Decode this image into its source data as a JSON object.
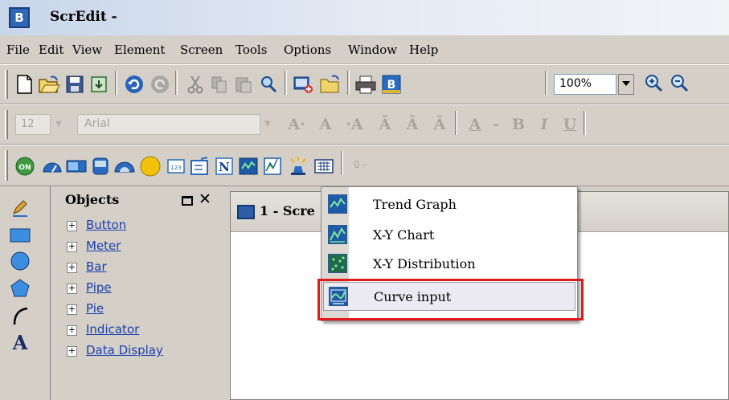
{
  "window": {
    "title": "ScrEdit -",
    "app_icon_letter": "B"
  },
  "menubar": {
    "items": [
      "File",
      "Edit",
      "View",
      "Element",
      "Screen",
      "Tools",
      "Options",
      "Window",
      "Help"
    ]
  },
  "toolbar_main": {
    "zoom_value": "100%",
    "icons": [
      "new-file-icon",
      "open-folder-icon",
      "save-icon",
      "import-icon",
      "undo-icon",
      "redo-icon",
      "cut-icon",
      "copy-icon",
      "paste-icon",
      "find-icon",
      "add-screen-icon",
      "open-screen-icon",
      "print-icon",
      "compile-icon",
      "zoom-in-icon",
      "zoom-out-icon"
    ]
  },
  "toolbar_format": {
    "font_size": "12",
    "font_name": "Arial",
    "buttons": [
      "A·",
      "A",
      "·A",
      "Ā",
      "Ā",
      "Ā",
      "A",
      "-",
      "B",
      "I",
      "U"
    ]
  },
  "toolbar_elements": {
    "icons": [
      "button-on-icon",
      "meter-icon",
      "bar-icon",
      "pipe-icon",
      "pie-icon",
      "indicator-icon",
      "data-display-icon",
      "input-icon",
      "numeric-icon",
      "trend-graph-icon",
      "xy-chart-icon",
      "alarm-icon",
      "keypad-icon"
    ],
    "right_field": "0 -"
  },
  "objects_panel": {
    "title": "Objects",
    "items": [
      "Button",
      "Meter",
      "Bar",
      "Pipe",
      "Pie",
      "Indicator",
      "Data Display"
    ]
  },
  "screen_window": {
    "title": "1 - Scre"
  },
  "context_menu": {
    "items": [
      {
        "label": "Trend Graph"
      },
      {
        "label": "X-Y Chart"
      },
      {
        "label": "X-Y Distribution"
      },
      {
        "label": "Curve input"
      }
    ],
    "highlighted_index": 3,
    "highlight_color": "#e01a1a"
  }
}
